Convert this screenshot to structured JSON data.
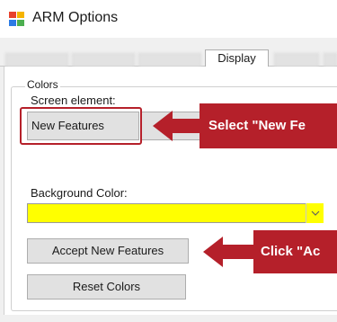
{
  "window": {
    "title": "ARM Options"
  },
  "tabs": [
    {
      "label": "Display",
      "selected": true
    }
  ],
  "colors_group": {
    "legend": "Colors",
    "screen_element_label": "Screen element:",
    "screen_element_selected": "New Features",
    "background_color_label": "Background Color:",
    "background_color_value": "#ffff00",
    "accept_button_label": "Accept New Features",
    "reset_button_label": "Reset Colors"
  },
  "annotations": {
    "callout_1": "Select \"New Fe",
    "callout_2": "Click \"Ac",
    "accent_color": "#b5202a"
  }
}
